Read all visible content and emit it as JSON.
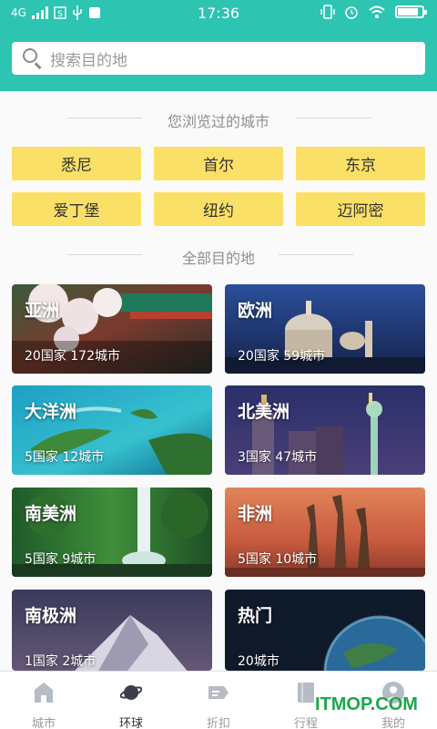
{
  "status_bar": {
    "network": "4G",
    "time": "17:36"
  },
  "search": {
    "placeholder": "搜索目的地"
  },
  "recent": {
    "title": "您浏览过的城市",
    "cities": [
      "悉尼",
      "首尔",
      "东京",
      "爱丁堡",
      "纽约",
      "迈阿密"
    ]
  },
  "all": {
    "title": "全部目的地",
    "regions": [
      {
        "name": "亚洲",
        "stats": "20国家 172城市"
      },
      {
        "name": "欧洲",
        "stats": "20国家 59城市"
      },
      {
        "name": "大洋洲",
        "stats": "5国家 12城市"
      },
      {
        "name": "北美洲",
        "stats": "3国家 47城市"
      },
      {
        "name": "南美洲",
        "stats": "5国家 9城市"
      },
      {
        "name": "非洲",
        "stats": "5国家 10城市"
      },
      {
        "name": "南极洲",
        "stats": "1国家 2城市"
      },
      {
        "name": "热门",
        "stats": "20城市"
      }
    ]
  },
  "tabs": [
    {
      "label": "城市",
      "icon": "home-icon",
      "active": false
    },
    {
      "label": "环球",
      "icon": "planet-icon",
      "active": true
    },
    {
      "label": "折扣",
      "icon": "tag-icon",
      "active": false
    },
    {
      "label": "行程",
      "icon": "book-icon",
      "active": false
    },
    {
      "label": "我的",
      "icon": "user-icon",
      "active": false
    }
  ],
  "watermark": "ITMOP.COM",
  "colors": {
    "accent": "#2ec4b2",
    "chip": "#fbe067"
  }
}
